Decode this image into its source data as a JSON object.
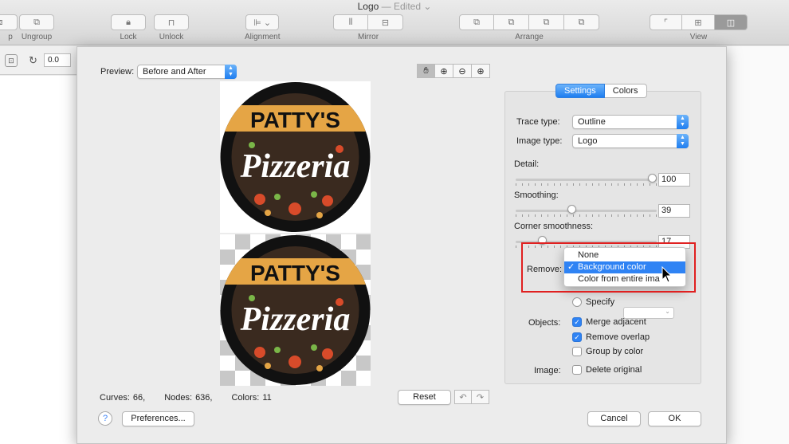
{
  "window": {
    "title": "Logo",
    "edited": "— Edited ⌄"
  },
  "toolbar": {
    "groups": [
      {
        "label": "p"
      },
      {
        "label": "Ungroup"
      },
      {
        "label": "Lock"
      },
      {
        "label": "Unlock"
      },
      {
        "label": "Alignment"
      },
      {
        "label": "Mirror"
      },
      {
        "label": "Arrange"
      },
      {
        "label": "View"
      }
    ]
  },
  "subbar": {
    "rotation_value": "0.0"
  },
  "sheet": {
    "preview_label": "Preview:",
    "preview_select": "Before and After",
    "logo": {
      "line1": "PATTY'S",
      "line2": "Pizzeria"
    },
    "stats": {
      "curves_label": "Curves:",
      "curves": "66,",
      "nodes_label": "Nodes:",
      "nodes": "636,",
      "colors_label": "Colors:",
      "colors": "11"
    },
    "reset_label": "Reset",
    "help_label": "?",
    "preferences_label": "Preferences...",
    "cancel_label": "Cancel",
    "ok_label": "OK"
  },
  "panel": {
    "tabs": [
      "Settings",
      "Colors"
    ],
    "trace_type_label": "Trace type:",
    "trace_type": "Outline",
    "image_type_label": "Image type:",
    "image_type": "Logo",
    "detail_label": "Detail:",
    "detail": "100",
    "smoothing_label": "Smoothing:",
    "smoothing": "39",
    "corner_label": "Corner smoothness:",
    "corner": "17",
    "remove_label": "Remove:",
    "remove_menu": [
      "None",
      "Background color",
      "Color from entire ima"
    ],
    "remove_selected_mark": "✓",
    "specify_label": "Specify",
    "objects_label": "Objects:",
    "merge_label": "Merge adjacent",
    "overlap_label": "Remove overlap",
    "group_label": "Group by color",
    "image_label": "Image:",
    "delete_label": "Delete original"
  },
  "sliders": {
    "detail": 1.0,
    "smoothing": 0.39,
    "corner": 0.17
  },
  "colors": {
    "accent": "#2f83f4",
    "highlight": "#e02020",
    "logo_orange": "#e5a545",
    "logo_black": "#111111"
  }
}
